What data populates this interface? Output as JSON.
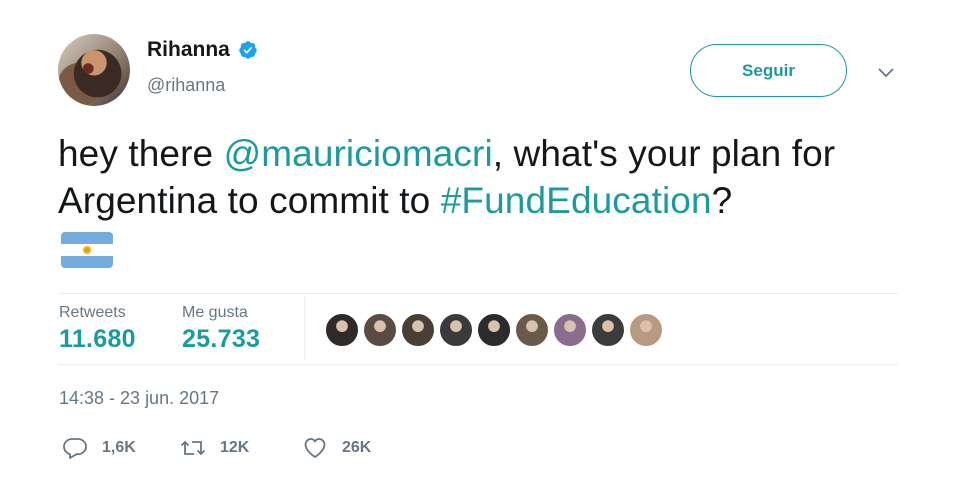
{
  "user": {
    "display_name": "Rihanna",
    "handle": "@rihanna",
    "verified": true,
    "verified_color": "#1da1f2"
  },
  "follow_button": {
    "label": "Seguir"
  },
  "tweet": {
    "segments": [
      {
        "text": "hey there ",
        "link": false
      },
      {
        "text": "@mauriciomacri",
        "link": true
      },
      {
        "text": ", what's your plan for Argentina to commit to ",
        "link": false
      },
      {
        "text": "#FundEducation",
        "link": true
      },
      {
        "text": "?",
        "link": false
      }
    ],
    "emoji": "argentina-flag-icon"
  },
  "stats": {
    "retweets_label": "Retweets",
    "retweets_value": "11.680",
    "likes_label": "Me gusta",
    "likes_value": "25.733"
  },
  "liker_avatars": [
    {
      "name": "liker-avatar-1",
      "color": "#2e2a28"
    },
    {
      "name": "liker-avatar-2",
      "color": "#5b4b45"
    },
    {
      "name": "liker-avatar-3",
      "color": "#4a3f35"
    },
    {
      "name": "liker-avatar-4",
      "color": "#3a3a3a"
    },
    {
      "name": "liker-avatar-5",
      "color": "#2b2b2b"
    },
    {
      "name": "liker-avatar-6",
      "color": "#6a5a4a"
    },
    {
      "name": "liker-avatar-7",
      "color": "#8a6c8e"
    },
    {
      "name": "liker-avatar-8",
      "color": "#3c3c3c"
    },
    {
      "name": "liker-avatar-9",
      "color": "#b89a80"
    }
  ],
  "timestamp": "14:38 - 23 jun. 2017",
  "actions": {
    "reply_count": "1,6K",
    "retweet_count": "12K",
    "like_count": "26K"
  },
  "colors": {
    "accent": "#1b9ba0",
    "secondary_text": "#657786",
    "divider": "#e6ecf0"
  }
}
